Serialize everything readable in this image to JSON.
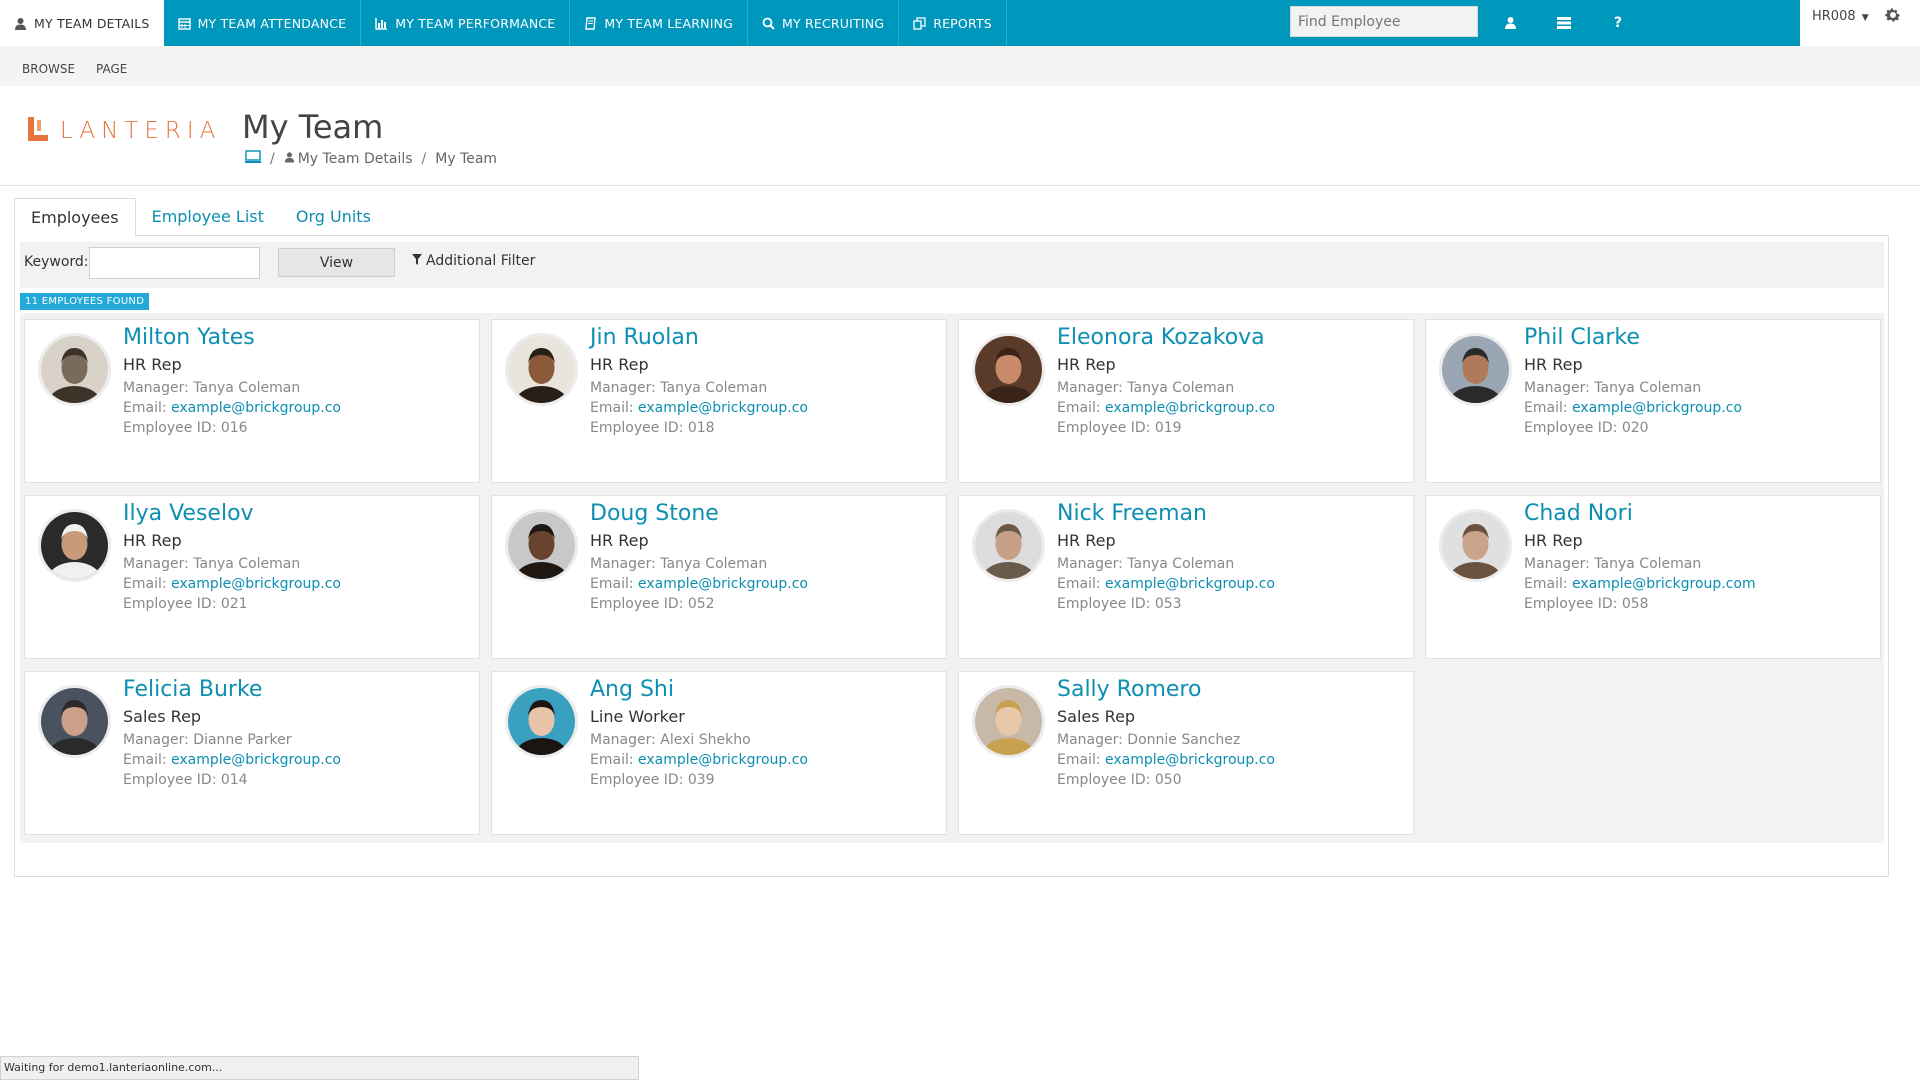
{
  "nav": {
    "tabs": [
      {
        "label": "MY TEAM DETAILS",
        "icon": "user-icon"
      },
      {
        "label": "MY TEAM ATTENDANCE",
        "icon": "calendar-icon"
      },
      {
        "label": "MY TEAM PERFORMANCE",
        "icon": "bar-chart-icon"
      },
      {
        "label": "MY TEAM LEARNING",
        "icon": "book-icon"
      },
      {
        "label": "MY RECRUITING",
        "icon": "search-icon"
      },
      {
        "label": "REPORTS",
        "icon": "copy-icon"
      }
    ],
    "search_placeholder": "Find Employee",
    "help_label": "?",
    "user": "HR008",
    "accent": "#0097bc"
  },
  "ribbon": {
    "browse": "BROWSE",
    "page": "PAGE"
  },
  "header": {
    "logo_text": "LANTERIA",
    "title": "My Team",
    "breadcrumb": [
      "My Team Details",
      "My Team"
    ],
    "breadcrumb_sep": "/"
  },
  "tabs": [
    "Employees",
    "Employee List",
    "Org Units"
  ],
  "filter": {
    "keyword_label": "Keyword:",
    "keyword_value": "",
    "view_label": "View",
    "additional_filter": "Additional Filter"
  },
  "found_label": "11 EMPLOYEES FOUND",
  "employees": [
    {
      "name": "Milton Yates",
      "role": "HR Rep",
      "manager": "Manager: Tanya Coleman",
      "email_label": "Email:",
      "email": "example@brickgroup.co",
      "id": "Employee ID: 016"
    },
    {
      "name": "Jin Ruolan",
      "role": "HR Rep",
      "manager": "Manager: Tanya Coleman",
      "email_label": "Email:",
      "email": "example@brickgroup.co",
      "id": "Employee ID: 018"
    },
    {
      "name": "Eleonora Kozakova",
      "role": "HR Rep",
      "manager": "Manager: Tanya Coleman",
      "email_label": "Email:",
      "email": "example@brickgroup.co",
      "id": "Employee ID: 019"
    },
    {
      "name": "Phil Clarke",
      "role": "HR Rep",
      "manager": "Manager: Tanya Coleman",
      "email_label": "Email:",
      "email": "example@brickgroup.co",
      "id": "Employee ID: 020"
    },
    {
      "name": "Ilya Veselov",
      "role": "HR Rep",
      "manager": "Manager: Tanya Coleman",
      "email_label": "Email:",
      "email": "example@brickgroup.co",
      "id": "Employee ID: 021"
    },
    {
      "name": "Doug Stone",
      "role": "HR Rep",
      "manager": "Manager: Tanya Coleman",
      "email_label": "Email:",
      "email": "example@brickgroup.co",
      "id": "Employee ID: 052"
    },
    {
      "name": "Nick Freeman",
      "role": "HR Rep",
      "manager": "Manager: Tanya Coleman",
      "email_label": "Email:",
      "email": "example@brickgroup.co",
      "id": "Employee ID: 053"
    },
    {
      "name": "Chad Nori",
      "role": "HR Rep",
      "manager": "Manager: Tanya Coleman",
      "email_label": "Email:",
      "email": "example@brickgroup.com",
      "id": "Employee ID: 058"
    },
    {
      "name": "Felicia Burke",
      "role": "Sales Rep",
      "manager": "Manager: Dianne Parker",
      "email_label": "Email:",
      "email": "example@brickgroup.co",
      "id": "Employee ID: 014"
    },
    {
      "name": "Ang Shi",
      "role": "Line Worker",
      "manager": "Manager: Alexi Shekho",
      "email_label": "Email:",
      "email": "example@brickgroup.co",
      "id": "Employee ID: 039"
    },
    {
      "name": "Sally Romero",
      "role": "Sales Rep",
      "manager": "Manager: Donnie Sanchez",
      "email_label": "Email:",
      "email": "example@brickgroup.co",
      "id": "Employee ID: 050"
    }
  ],
  "status": "Waiting for demo1.lanteriaonline.com..."
}
